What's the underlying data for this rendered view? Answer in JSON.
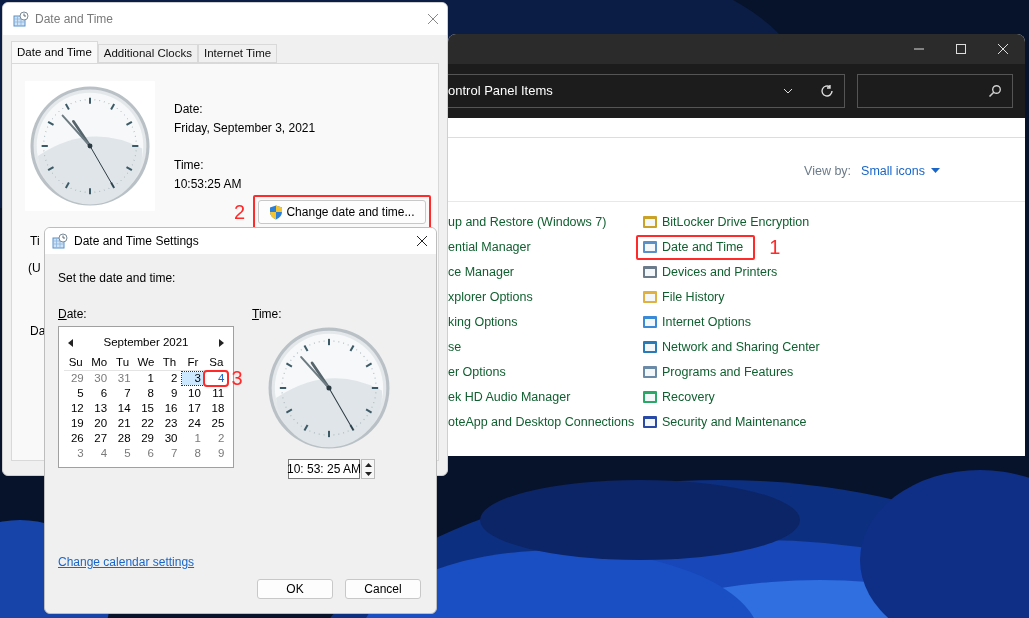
{
  "control_panel": {
    "address": "ontrol Panel Items",
    "view_by_label": "View by:",
    "view_by_value": "Small icons",
    "column_1": [
      "up and Restore (Windows 7)",
      "ential Manager",
      "ce Manager",
      "xplorer Options",
      "king Options",
      "se",
      "er Options",
      "ek HD Audio Manager",
      "oteApp and Desktop Connections"
    ],
    "column_2": [
      {
        "label": "BitLocker Drive Encryption"
      },
      {
        "label": "Date and Time",
        "callout": "1"
      },
      {
        "label": "Devices and Printers"
      },
      {
        "label": "File History"
      },
      {
        "label": "Internet Options"
      },
      {
        "label": "Network and Sharing Center"
      },
      {
        "label": "Programs and Features"
      },
      {
        "label": "Recovery"
      },
      {
        "label": "Security and Maintenance"
      }
    ]
  },
  "date_time_dialog": {
    "title": "Date and Time",
    "tabs": [
      {
        "label": "Date and Time",
        "selected": true
      },
      {
        "label": "Additional Clocks",
        "selected": false
      },
      {
        "label": "Internet Time",
        "selected": false
      }
    ],
    "date_label": "Date:",
    "date_value": "Friday, September 3, 2021",
    "time_label": "Time:",
    "time_value": "10:53:25 AM",
    "change_button": {
      "label": "Change date and time...",
      "callout": "2"
    },
    "clipped_labels": [
      "Ti",
      "(U",
      "Da"
    ]
  },
  "settings_dialog": {
    "title": "Date and Time Settings",
    "instruction": "Set the date and time:",
    "date_label": "Date:",
    "time_label": "Time:",
    "calendar": {
      "month": "September 2021",
      "weekdays": [
        "Su",
        "Mo",
        "Tu",
        "We",
        "Th",
        "Fr",
        "Sa"
      ],
      "days": [
        {
          "day": "29",
          "kind": "other",
          "selected": false
        },
        {
          "day": "30",
          "kind": "other",
          "selected": false
        },
        {
          "day": "31",
          "kind": "other",
          "selected": false
        },
        {
          "day": "1",
          "kind": "month",
          "selected": false
        },
        {
          "day": "2",
          "kind": "month",
          "selected": false
        },
        {
          "day": "3",
          "kind": "month",
          "selected": true
        },
        {
          "day": "4",
          "kind": "today",
          "selected": false,
          "callout": "3"
        },
        {
          "day": "5",
          "kind": "month",
          "selected": false
        },
        {
          "day": "6",
          "kind": "month",
          "selected": false
        },
        {
          "day": "7",
          "kind": "month",
          "selected": false
        },
        {
          "day": "8",
          "kind": "month",
          "selected": false
        },
        {
          "day": "9",
          "kind": "month",
          "selected": false
        },
        {
          "day": "10",
          "kind": "month",
          "selected": false
        },
        {
          "day": "11",
          "kind": "month",
          "selected": false
        },
        {
          "day": "12",
          "kind": "month",
          "selected": false
        },
        {
          "day": "13",
          "kind": "month",
          "selected": false
        },
        {
          "day": "14",
          "kind": "month",
          "selected": false
        },
        {
          "day": "15",
          "kind": "month",
          "selected": false
        },
        {
          "day": "16",
          "kind": "month",
          "selected": false
        },
        {
          "day": "17",
          "kind": "month",
          "selected": false
        },
        {
          "day": "18",
          "kind": "month",
          "selected": false
        },
        {
          "day": "19",
          "kind": "month",
          "selected": false
        },
        {
          "day": "20",
          "kind": "month",
          "selected": false
        },
        {
          "day": "21",
          "kind": "month",
          "selected": false
        },
        {
          "day": "22",
          "kind": "month",
          "selected": false
        },
        {
          "day": "23",
          "kind": "month",
          "selected": false
        },
        {
          "day": "24",
          "kind": "month",
          "selected": false
        },
        {
          "day": "25",
          "kind": "month",
          "selected": false
        },
        {
          "day": "26",
          "kind": "month",
          "selected": false
        },
        {
          "day": "27",
          "kind": "month",
          "selected": false
        },
        {
          "day": "28",
          "kind": "month",
          "selected": false
        },
        {
          "day": "29",
          "kind": "month",
          "selected": false
        },
        {
          "day": "30",
          "kind": "month",
          "selected": false
        },
        {
          "day": "1",
          "kind": "other",
          "selected": false
        },
        {
          "day": "2",
          "kind": "other",
          "selected": false
        },
        {
          "day": "3",
          "kind": "other",
          "selected": false
        },
        {
          "day": "4",
          "kind": "other",
          "selected": false
        },
        {
          "day": "5",
          "kind": "other",
          "selected": false
        },
        {
          "day": "6",
          "kind": "other",
          "selected": false
        },
        {
          "day": "7",
          "kind": "other",
          "selected": false
        },
        {
          "day": "8",
          "kind": "other",
          "selected": false
        },
        {
          "day": "9",
          "kind": "other",
          "selected": false
        }
      ]
    },
    "time_value": "10: 53: 25 AM",
    "link": "Change calendar settings",
    "buttons": [
      "OK",
      "Cancel"
    ]
  }
}
